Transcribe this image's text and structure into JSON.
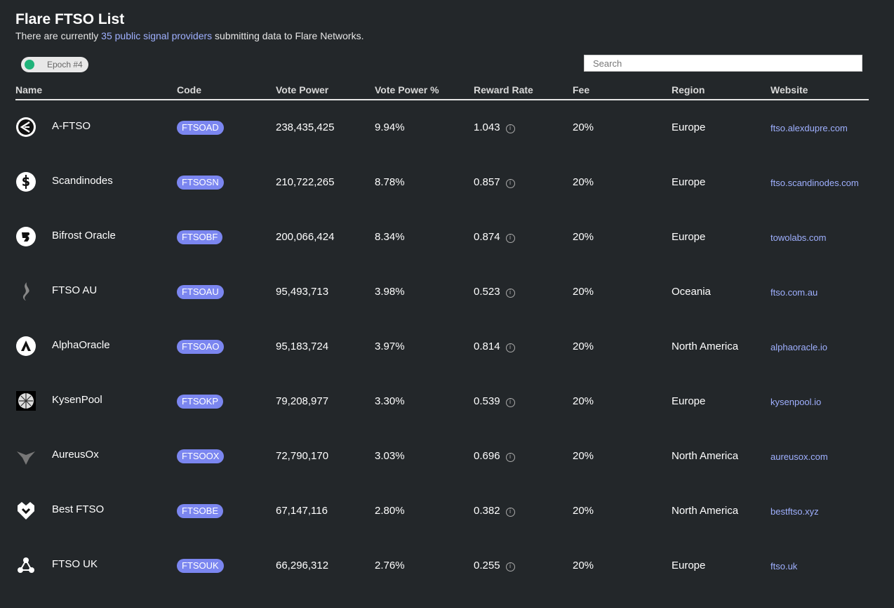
{
  "header": {
    "title": "Flare FTSO List",
    "subtitle_prefix": "There are currently ",
    "subtitle_link": "35 public signal providers",
    "subtitle_suffix": " submitting data to Flare Networks."
  },
  "epoch": {
    "label": "Epoch #4"
  },
  "search": {
    "placeholder": "Search",
    "value": ""
  },
  "colors": {
    "background": "#23272a",
    "code_badge": "#7b86f0",
    "link": "#9fb0ff",
    "toggle": "#1fb37a"
  },
  "columns": {
    "name": "Name",
    "code": "Code",
    "vote_power": "Vote Power",
    "vote_power_pct": "Vote Power %",
    "reward_rate": "Reward Rate",
    "fee": "Fee",
    "region": "Region",
    "website": "Website"
  },
  "providers": [
    {
      "logo": "a-ftso-logo-icon",
      "name": "A-FTSO",
      "code": "FTSOAD",
      "vote_power": "238,435,425",
      "vote_power_pct": "9.94%",
      "reward_rate": "1.043",
      "fee": "20%",
      "region": "Europe",
      "website": "ftso.alexdupre.com"
    },
    {
      "logo": "scandinodes-logo-icon",
      "name": "Scandinodes",
      "code": "FTSOSN",
      "vote_power": "210,722,265",
      "vote_power_pct": "8.78%",
      "reward_rate": "0.857",
      "fee": "20%",
      "region": "Europe",
      "website": "ftso.scandinodes.com"
    },
    {
      "logo": "bifrost-logo-icon",
      "name": "Bifrost Oracle",
      "code": "FTSOBF",
      "vote_power": "200,066,424",
      "vote_power_pct": "8.34%",
      "reward_rate": "0.874",
      "fee": "20%",
      "region": "Europe",
      "website": "towolabs.com"
    },
    {
      "logo": "ftso-au-logo-icon",
      "name": "FTSO AU",
      "code": "FTSOAU",
      "vote_power": "95,493,713",
      "vote_power_pct": "3.98%",
      "reward_rate": "0.523",
      "fee": "20%",
      "region": "Oceania",
      "website": "ftso.com.au"
    },
    {
      "logo": "alphaoracle-logo-icon",
      "name": "AlphaOracle",
      "code": "FTSOAO",
      "vote_power": "95,183,724",
      "vote_power_pct": "3.97%",
      "reward_rate": "0.814",
      "fee": "20%",
      "region": "North America",
      "website": "alphaoracle.io"
    },
    {
      "logo": "kysenpool-logo-icon",
      "name": "KysenPool",
      "code": "FTSOKP",
      "vote_power": "79,208,977",
      "vote_power_pct": "3.30%",
      "reward_rate": "0.539",
      "fee": "20%",
      "region": "Europe",
      "website": "kysenpool.io"
    },
    {
      "logo": "aureusox-logo-icon",
      "name": "AureusOx",
      "code": "FTSOOX",
      "vote_power": "72,790,170",
      "vote_power_pct": "3.03%",
      "reward_rate": "0.696",
      "fee": "20%",
      "region": "North America",
      "website": "aureusox.com"
    },
    {
      "logo": "best-ftso-logo-icon",
      "name": "Best FTSO",
      "code": "FTSOBE",
      "vote_power": "67,147,116",
      "vote_power_pct": "2.80%",
      "reward_rate": "0.382",
      "fee": "20%",
      "region": "North America",
      "website": "bestftso.xyz"
    },
    {
      "logo": "ftso-uk-logo-icon",
      "name": "FTSO UK",
      "code": "FTSOUK",
      "vote_power": "66,296,312",
      "vote_power_pct": "2.76%",
      "reward_rate": "0.255",
      "fee": "20%",
      "region": "Europe",
      "website": "ftso.uk"
    }
  ]
}
